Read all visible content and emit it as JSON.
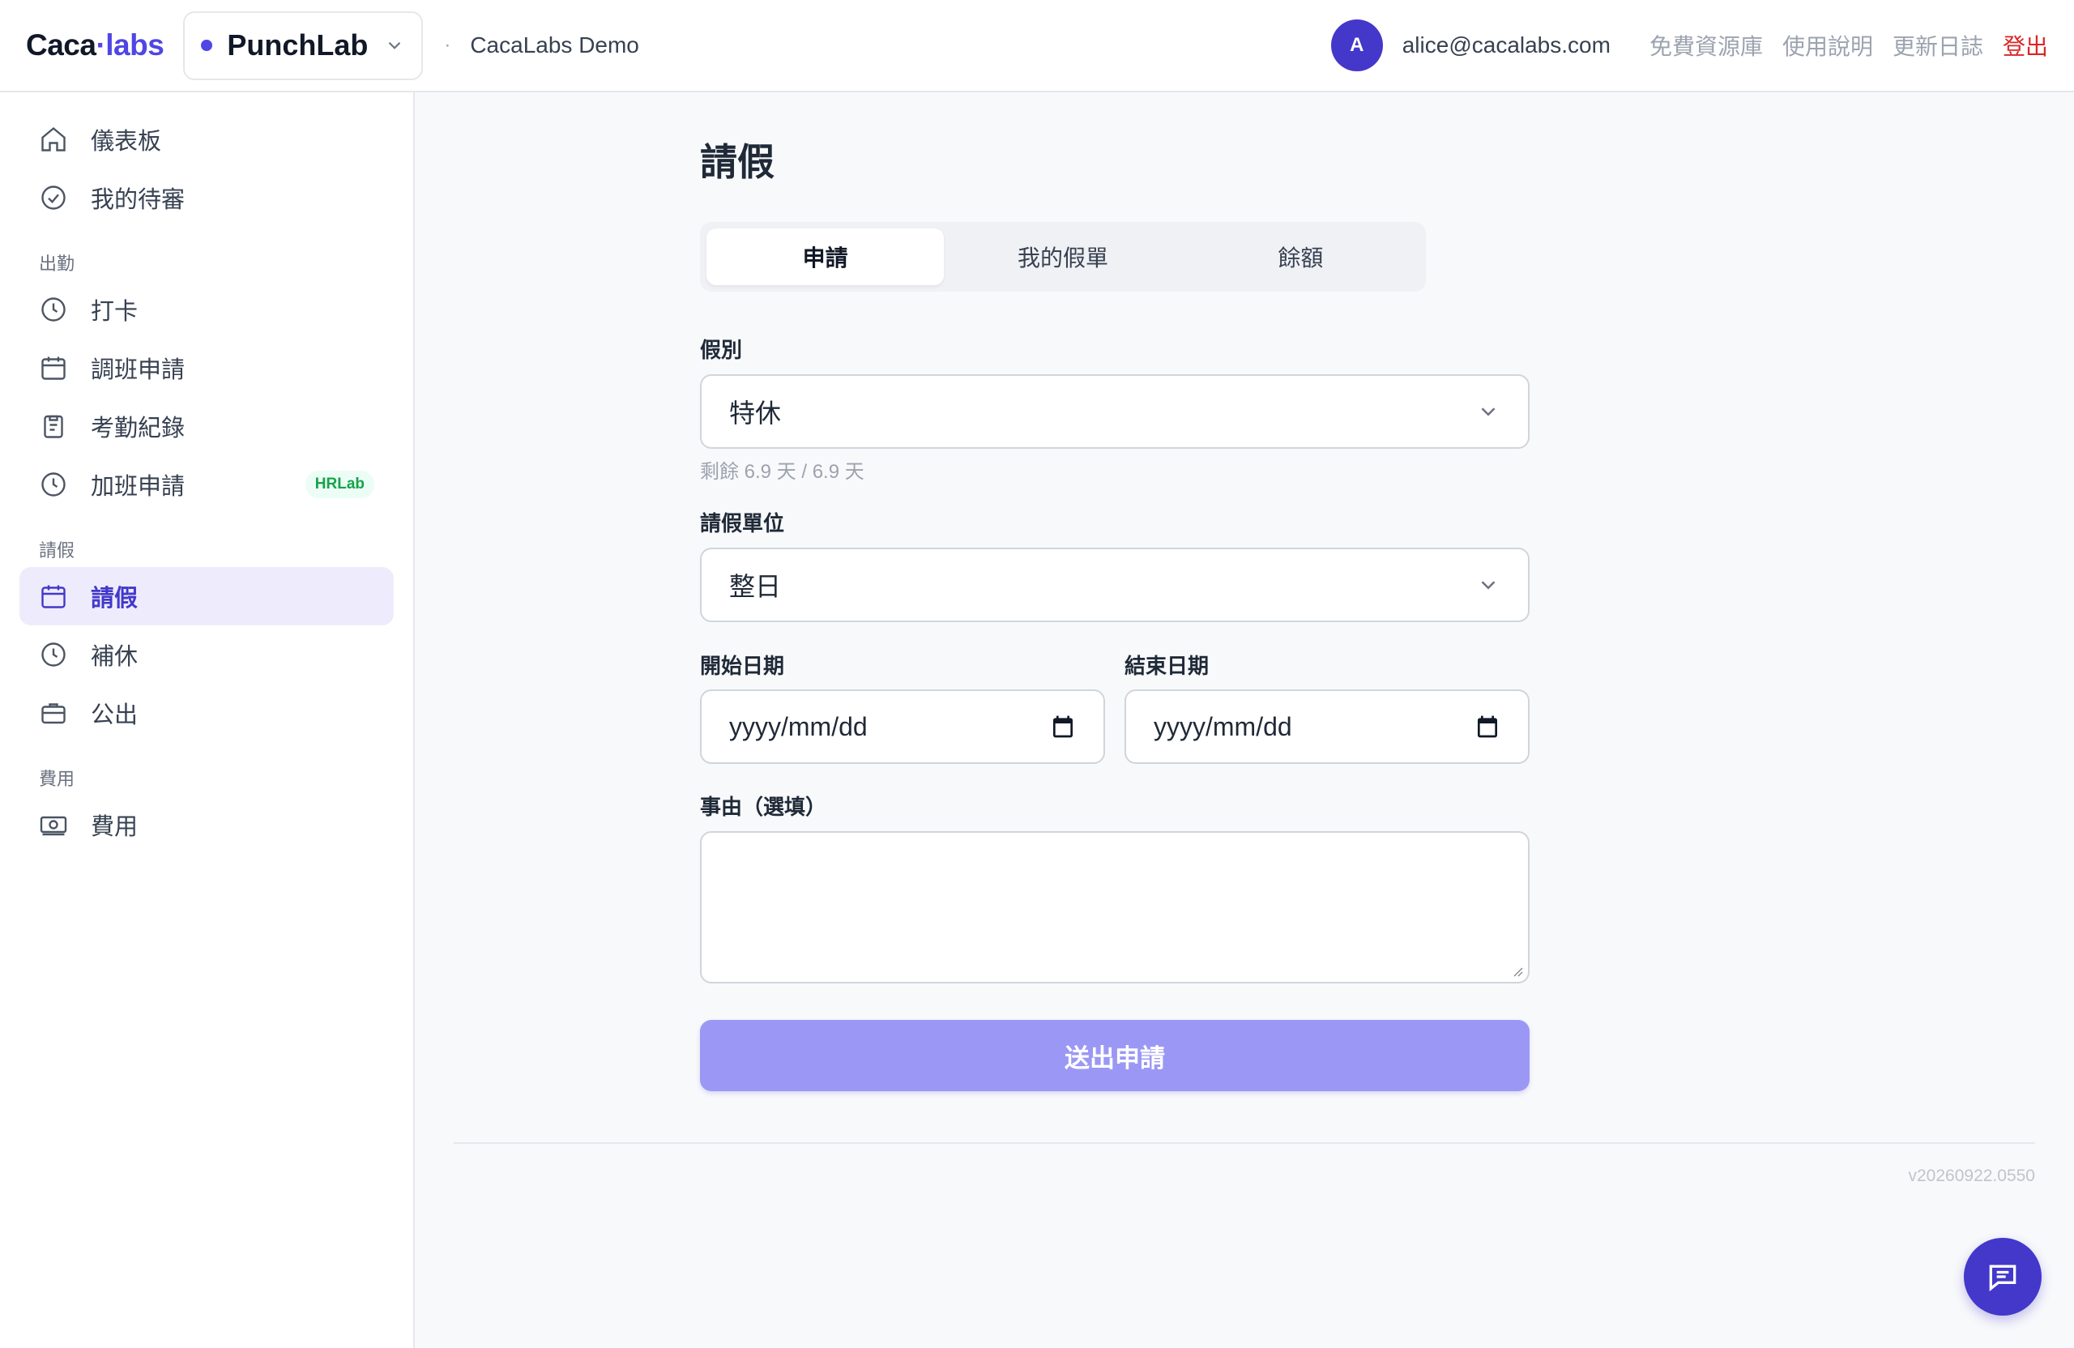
{
  "header": {
    "logo_left": "Caca",
    "logo_dot": "·",
    "logo_right": "labs",
    "app_name": "PunchLab",
    "org_sep": "·",
    "org_name": "CacaLabs Demo",
    "avatar_initial": "A",
    "email": "alice@cacalabs.com",
    "links": [
      "免費資源庫",
      "使用說明",
      "更新日誌"
    ],
    "logout": "登出"
  },
  "sidebar": {
    "top_items": [
      {
        "label": "儀表板",
        "icon": "home-icon"
      },
      {
        "label": "我的待審",
        "icon": "check-circle-icon"
      }
    ],
    "sections": [
      {
        "title": "出勤",
        "items": [
          {
            "label": "打卡",
            "icon": "clock-icon"
          },
          {
            "label": "調班申請",
            "icon": "calendar-icon"
          },
          {
            "label": "考勤紀錄",
            "icon": "clipboard-icon"
          },
          {
            "label": "加班申請",
            "icon": "clock-icon",
            "badge": "HRLab"
          }
        ]
      },
      {
        "title": "請假",
        "items": [
          {
            "label": "請假",
            "icon": "calendar-icon",
            "active": true
          },
          {
            "label": "補休",
            "icon": "clock-icon"
          },
          {
            "label": "公出",
            "icon": "briefcase-icon"
          }
        ]
      },
      {
        "title": "費用",
        "items": [
          {
            "label": "費用",
            "icon": "cash-icon"
          }
        ]
      }
    ]
  },
  "main": {
    "title": "請假",
    "tabs": [
      {
        "label": "申請",
        "active": true
      },
      {
        "label": "我的假單"
      },
      {
        "label": "餘額"
      }
    ],
    "leave_type": {
      "label": "假別",
      "value": "特休",
      "hint": "剩餘 6.9 天 / 6.9 天"
    },
    "unit": {
      "label": "請假單位",
      "value": "整日"
    },
    "start_date": {
      "label": "開始日期",
      "placeholder": "yyyy/mm/dd"
    },
    "end_date": {
      "label": "結束日期",
      "placeholder": "yyyy/mm/dd"
    },
    "reason": {
      "label": "事由（選填）",
      "value": ""
    },
    "submit": "送出申請",
    "version": "v20260922.0550"
  },
  "colors": {
    "accent": "#4f46e5",
    "logout": "#dc2626",
    "submit_disabled": "#9b98f5"
  }
}
